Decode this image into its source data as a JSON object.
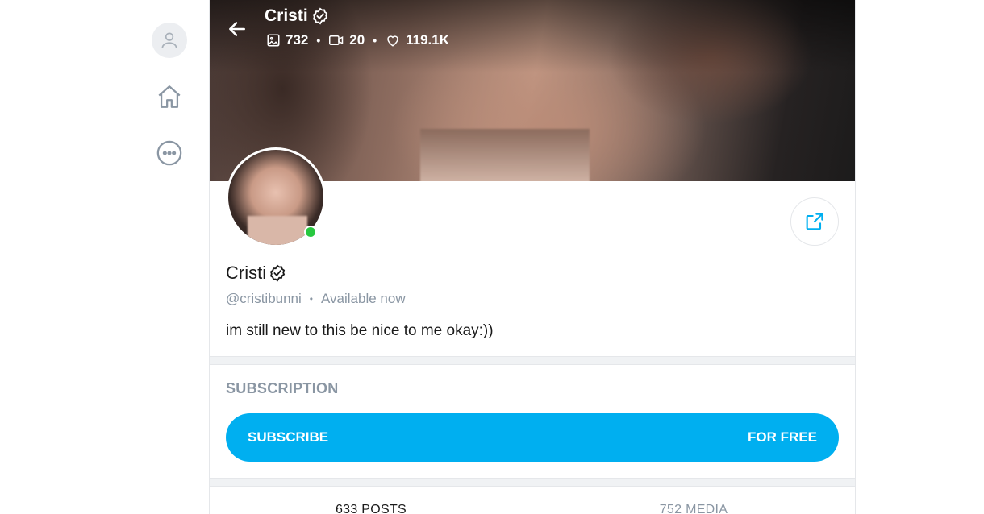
{
  "sidebar": {
    "items": [
      {
        "name": "profile",
        "icon": "user-icon"
      },
      {
        "name": "home",
        "icon": "home-icon"
      },
      {
        "name": "more",
        "icon": "more-horizontal-icon"
      }
    ]
  },
  "header": {
    "name": "Cristi",
    "verified_icon": "verified-badge-icon",
    "stats": {
      "photos": "732",
      "videos": "20",
      "likes": "119.1K"
    }
  },
  "profile": {
    "name": "Cristi",
    "handle": "@cristibunni",
    "status": "Available now",
    "bio": "im still new to this be nice to me okay:))",
    "online": true
  },
  "subscription": {
    "title": "SUBSCRIPTION",
    "button_label": "SUBSCRIBE",
    "price_label": "FOR FREE"
  },
  "tabs": [
    {
      "label": "633 POSTS",
      "active": true
    },
    {
      "label": "752 MEDIA",
      "active": false
    }
  ],
  "colors": {
    "accent": "#00aff0",
    "muted": "#8a96a3",
    "online": "#28c840"
  }
}
